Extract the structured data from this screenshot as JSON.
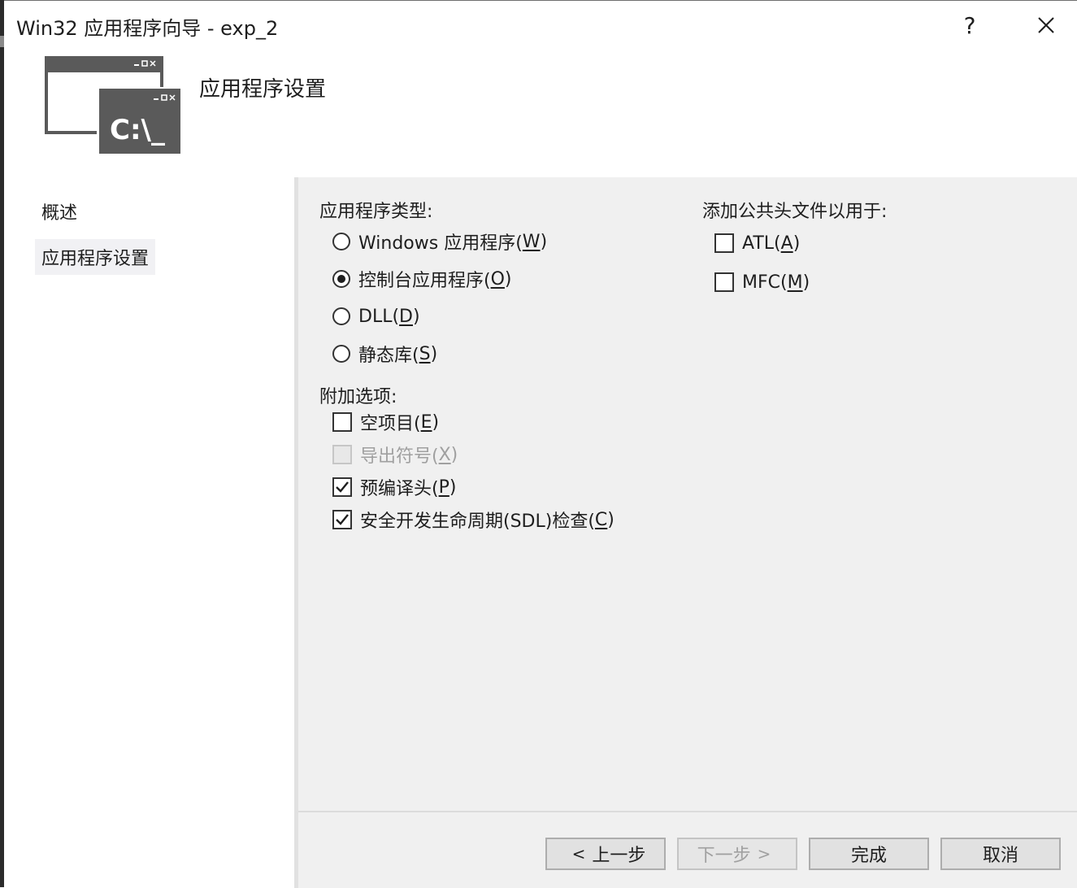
{
  "window": {
    "title": "Win32 应用程序向导 - exp_2",
    "help_label": "?",
    "close_label": "✕"
  },
  "header": {
    "title": "应用程序设置",
    "icon": "console-window-icon",
    "icon_text": "C:\\_"
  },
  "sidebar": {
    "items": [
      {
        "label": "概述"
      },
      {
        "label": "应用程序设置",
        "selected": true
      }
    ]
  },
  "app_type": {
    "label": "应用程序类型:",
    "options": [
      {
        "text": "Windows 应用程序(",
        "mnemonic": "W",
        "suffix": ")",
        "checked": false
      },
      {
        "text": "控制台应用程序(",
        "mnemonic": "O",
        "suffix": ")",
        "checked": true
      },
      {
        "text": "DLL(",
        "mnemonic": "D",
        "suffix": ")",
        "checked": false
      },
      {
        "text": "静态库(",
        "mnemonic": "S",
        "suffix": ")",
        "checked": false
      }
    ]
  },
  "extra_options": {
    "label": "附加选项:",
    "options": [
      {
        "text": "空项目(",
        "mnemonic": "E",
        "suffix": ")",
        "checked": false,
        "enabled": true
      },
      {
        "text": "导出符号(",
        "mnemonic": "X",
        "suffix": ")",
        "checked": false,
        "enabled": false
      },
      {
        "text": "预编译头(",
        "mnemonic": "P",
        "suffix": ")",
        "checked": true,
        "enabled": true
      },
      {
        "text": "安全开发生命周期(SDL)检查(",
        "mnemonic": "C",
        "suffix": ")",
        "checked": true,
        "enabled": true
      }
    ]
  },
  "common_headers": {
    "label": "添加公共头文件以用于:",
    "options": [
      {
        "text": "ATL(",
        "mnemonic": "A",
        "suffix": ")",
        "checked": false
      },
      {
        "text": "MFC(",
        "mnemonic": "M",
        "suffix": ")",
        "checked": false
      }
    ]
  },
  "buttons": {
    "prev": {
      "label": "上一步",
      "chevron": "<",
      "enabled": true
    },
    "next": {
      "label": "下一步",
      "chevron": ">",
      "enabled": false
    },
    "finish": {
      "label": "完成"
    },
    "cancel": {
      "label": "取消"
    }
  },
  "colors": {
    "content_bg": "#f0f0f0",
    "text": "#1e1e1e",
    "disabled_text": "#a0a0a0",
    "icon_gray": "#5a5a5a"
  }
}
